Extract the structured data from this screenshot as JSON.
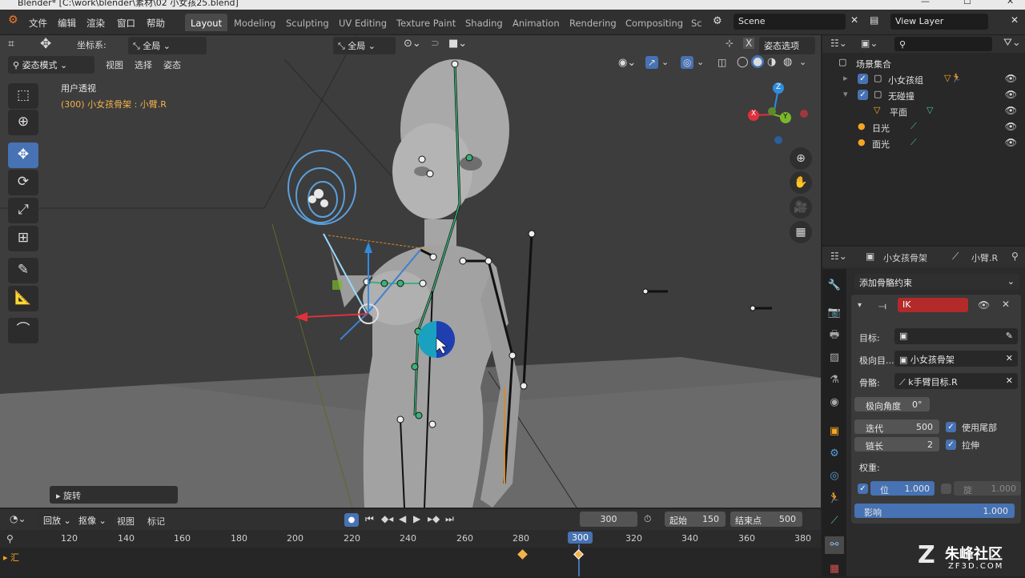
{
  "title": "Blender* [C:\\work\\blender\\素材\\02 小女孩25.blend]",
  "window_controls": {
    "minimize": "—",
    "maximize": "☐",
    "close": "✕"
  },
  "menu": [
    "文件",
    "编辑",
    "渲染",
    "窗口",
    "帮助"
  ],
  "workspaces": [
    "Layout",
    "Modeling",
    "Sculpting",
    "UV Editing",
    "Texture Paint",
    "Shading",
    "Animation",
    "Rendering",
    "Compositing",
    "Sc"
  ],
  "active_workspace": "Layout",
  "scene": "Scene",
  "view_layer": "View Layer",
  "header": {
    "coord_label": "坐标系:",
    "coord_value": "全局",
    "orientation": "全局",
    "pose_options": "姿态选项",
    "mode": "姿态模式",
    "view": "视图",
    "select": "选择",
    "pose": "姿态"
  },
  "overlay_text": {
    "view_name": "用户透视",
    "object_info": "(300) 小女孩骨架 : 小臂.R"
  },
  "last_op": "旋转",
  "gizmo": {
    "x": "X",
    "y": "Y",
    "z": "Z"
  },
  "outliner": {
    "search_placeholder": "",
    "root": "场景集合",
    "items": [
      {
        "label": "小女孩组",
        "indent": 1
      },
      {
        "label": "无碰撞",
        "indent": 1
      },
      {
        "label": "平面",
        "indent": 2
      },
      {
        "label": "日光",
        "indent": 1
      },
      {
        "label": "面光",
        "indent": 1
      }
    ]
  },
  "properties": {
    "object": "小女孩骨架",
    "bone": "小臂.R",
    "add_constraint": "添加骨骼约束",
    "constraint_name": "IK",
    "target_label": "目标:",
    "pole_target_label": "极向目...",
    "pole_target_value": "小女孩骨架",
    "bone_label": "骨骼:",
    "bone_value": "k手臂目标.R",
    "pole_angle": "极向角度",
    "pole_angle_value": "0°",
    "iterations_label": "迭代",
    "iterations_value": "500",
    "chain_label": "链长",
    "chain_value": "2",
    "use_tail": "使用尾部",
    "stretch": "拉伸",
    "weight_label": "权重:",
    "position_label": "位",
    "position_value": "1.000",
    "rotation_label": "旋",
    "rotation_value": "1.000",
    "influence_label": "影响",
    "influence_value": "1.000"
  },
  "timeline": {
    "playback": "回放",
    "keying": "抠像",
    "view": "视图",
    "marker": "标记",
    "current_frame": "300",
    "start_label": "起始",
    "start": "150",
    "end_label": "结束点",
    "end": "500",
    "ruler": [
      "120",
      "140",
      "160",
      "180",
      "200",
      "220",
      "240",
      "260",
      "280",
      "300",
      "320",
      "340",
      "360",
      "380"
    ],
    "channel": "汇"
  },
  "watermark": {
    "text": "朱峰社区",
    "url": "ZF3D.COM"
  },
  "colors": {
    "accent": "#4772b3",
    "ik_red": "#b22a2a",
    "x_axis": "#e0303c",
    "y_axis": "#7ab82a",
    "z_axis": "#2f8dde"
  }
}
